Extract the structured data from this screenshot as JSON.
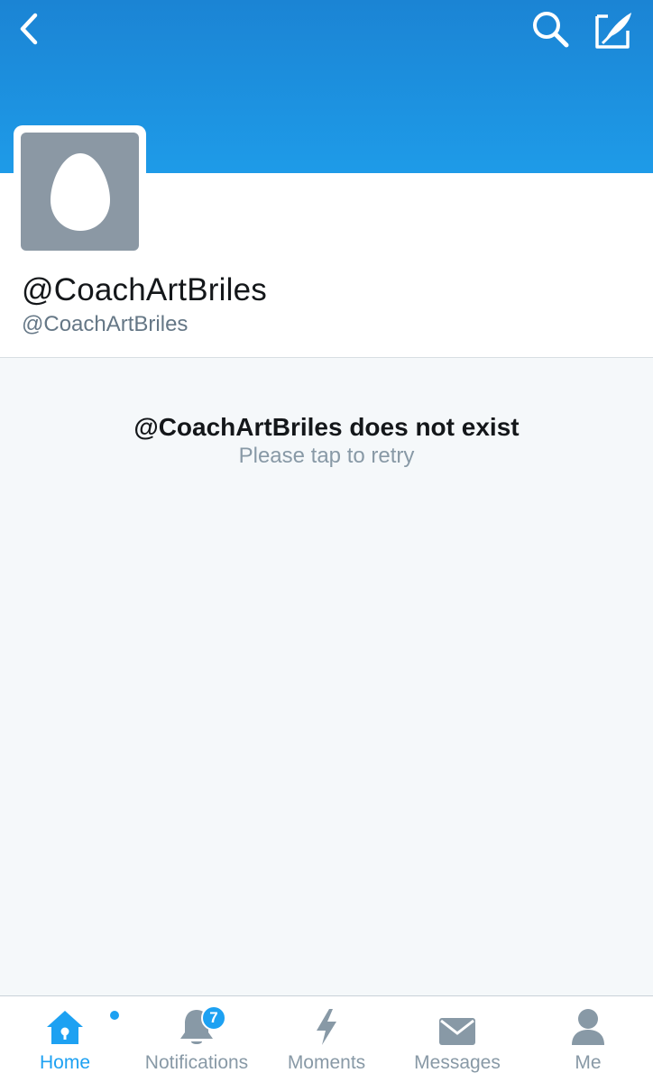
{
  "header": {
    "back_icon": "chevron-left-icon",
    "search_icon": "search-icon",
    "compose_icon": "compose-tweet-icon",
    "banner_color": "#1da1f2"
  },
  "profile": {
    "avatar_icon": "default-egg-avatar",
    "display_name": "@CoachArtBriles",
    "handle": "@CoachArtBriles"
  },
  "error": {
    "title": "@CoachArtBriles does not exist",
    "retry": "Please tap to retry"
  },
  "tabbar": {
    "accent_color": "#1da1f2",
    "tabs": [
      {
        "label": "Home",
        "icon": "home-icon",
        "active": true
      },
      {
        "label": "Notifications",
        "icon": "bell-icon",
        "badge": "7"
      },
      {
        "label": "Moments",
        "icon": "lightning-icon"
      },
      {
        "label": "Messages",
        "icon": "envelope-icon"
      },
      {
        "label": "Me",
        "icon": "person-icon"
      }
    ]
  }
}
